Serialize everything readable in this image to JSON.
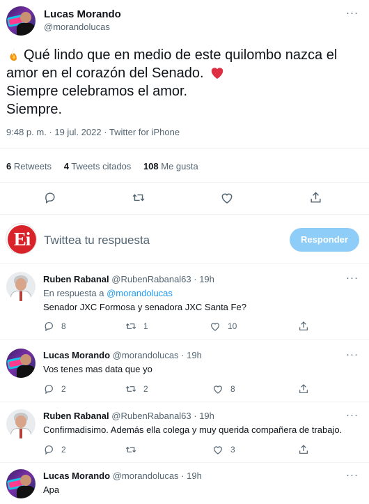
{
  "tweet": {
    "author_name": "Lucas Morando",
    "author_handle": "@morandolucas",
    "more": "···",
    "lines": [
      "Qué lindo que en medio de este quilombo nazca el",
      "amor en el corazón del Senado.",
      "Siempre celebramos el amor.",
      "Siempre."
    ],
    "meta": "9:48 p. m. · 19 jul. 2022 · Twitter for iPhone",
    "stats": {
      "retweets_count": "6",
      "retweets_label": "Retweets",
      "quotes_count": "4",
      "quotes_label": "Tweets citados",
      "likes_count": "108",
      "likes_label": "Me gusta"
    },
    "icons": [
      "fire-emoji",
      "heart-emoji",
      "reply-icon",
      "retweet-icon",
      "like-icon",
      "share-icon"
    ]
  },
  "compose": {
    "placeholder": "Twittea tu respuesta",
    "button_label": "Responder",
    "avatar_text": "Ei"
  },
  "replies": [
    {
      "name": "Ruben Rabanal",
      "handle": "@RubenRabanal63 · 19h",
      "reply_to_prefix": "En respuesta a ",
      "reply_to_handle": "@morandolucas",
      "text": "Senador JXC Formosa y senadora JXC Santa Fe?",
      "replies": "8",
      "retweets": "1",
      "likes": "10"
    },
    {
      "name": "Lucas Morando",
      "handle": "@morandolucas · 19h",
      "text": "Vos tenes mas data que yo",
      "replies": "2",
      "retweets": "2",
      "likes": "8"
    },
    {
      "name": "Ruben Rabanal",
      "handle": "@RubenRabanal63 · 19h",
      "text": "Confirmadisimo. Además ella colega y muy querida compañera de trabajo.",
      "replies": "2",
      "retweets": "",
      "likes": "3"
    },
    {
      "name": "Lucas Morando",
      "handle": "@morandolucas · 19h",
      "text": "Apa"
    }
  ],
  "colors": {
    "accent": "#1d9bf0",
    "reply_button": "#8ecdf8",
    "muted": "#536471",
    "heart": "#e0245e"
  }
}
